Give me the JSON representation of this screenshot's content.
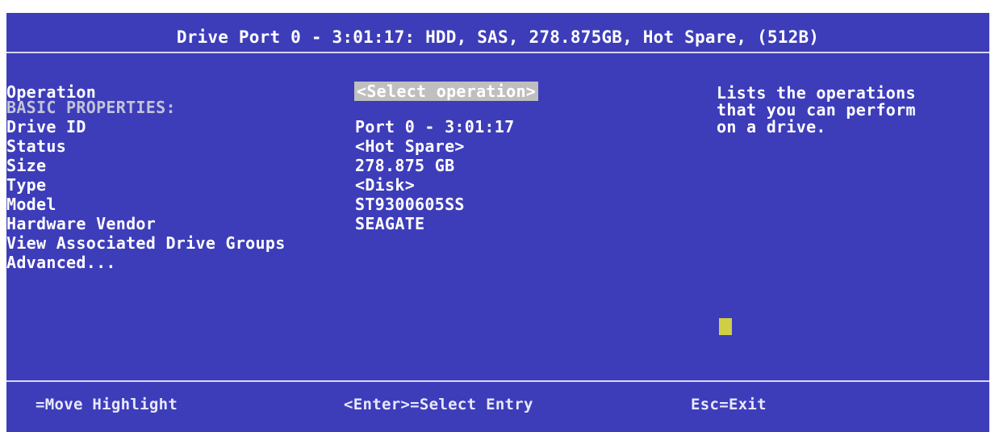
{
  "header": {
    "title": "Drive Port 0 - 3:01:17: HDD, SAS, 278.875GB, Hot Spare, (512B)"
  },
  "form": {
    "operation_label": "Operation",
    "operation_value": "<Select operation>",
    "section_label": "BASIC PROPERTIES:",
    "drive_id_label": "Drive ID",
    "drive_id_value": "Port 0 - 3:01:17",
    "status_label": "Status",
    "status_value": "<Hot Spare>",
    "size_label": "Size",
    "size_value": "278.875 GB",
    "type_label": "Type",
    "type_value": "<Disk>",
    "model_label": "Model",
    "model_value": "ST9300605SS",
    "vendor_label": "Hardware Vendor",
    "vendor_value": "SEAGATE",
    "view_groups_label": "View Associated Drive Groups",
    "advanced_label": "Advanced..."
  },
  "help": {
    "line1": "Lists the operations",
    "line2": "that you can perform",
    "line3": "on a drive."
  },
  "footer": {
    "move": "=Move Highlight",
    "enter": "<Enter>=Select Entry",
    "esc": "Esc=Exit"
  },
  "colors": {
    "background": "#3d3dba",
    "text": "#ffffff",
    "section_text": "#c3c3d8",
    "highlight": "#bfbfbf",
    "cursor": "#cfcf45"
  }
}
